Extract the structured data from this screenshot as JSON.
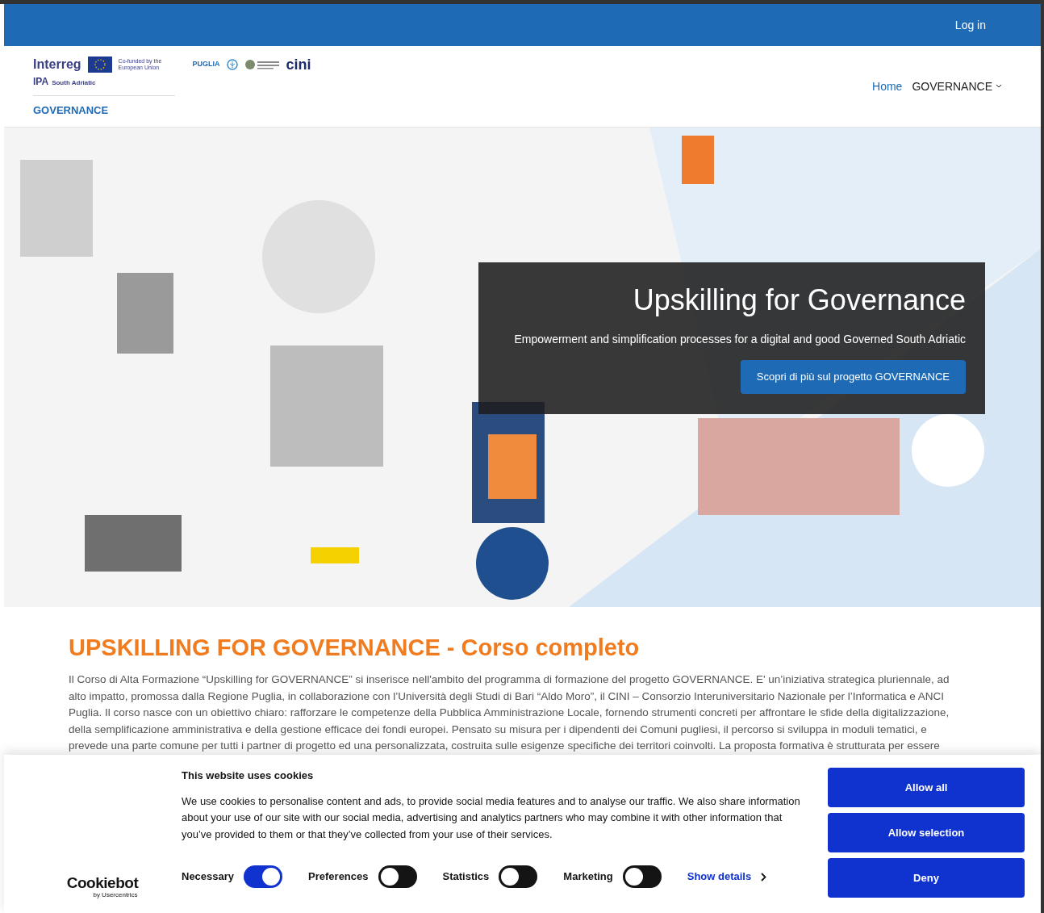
{
  "top_bar": {
    "login": "Log in"
  },
  "header": {
    "logos": {
      "interreg": "Interreg",
      "eu": "Co-funded by the European Union",
      "puglia": "PUGLIA",
      "cini": "cini",
      "ipa": "IPA",
      "region": "South Adriatic",
      "project": "GOVERNANCE"
    },
    "nav": [
      {
        "label": "Home",
        "selected": true,
        "dropdown": false
      },
      {
        "label": "GOVERNANCE",
        "selected": false,
        "dropdown": true
      }
    ]
  },
  "hero": {
    "title": "Upskilling for Governance",
    "subtitle": "Empowerment and simplification processes for a digital and good Governed South Adriatic",
    "button": "Scopri di più sul progetto GOVERNANCE"
  },
  "content": {
    "title": "UPSKILLING FOR GOVERNANCE - Corso completo",
    "paragraph": "Il Corso di Alta Formazione “Upskilling for GOVERNANCE” si inserisce nell'ambito del programma di formazione del progetto GOVERNANCE. E' un’iniziativa strategica pluriennale, ad alto impatto, promossa dalla Regione Puglia, in collaborazione con l’Università degli Studi di Bari “Aldo Moro”, il CINI – Consorzio Interuniversitario Nazionale per l’Informatica e ANCI Puglia. Il corso nasce con un obiettivo chiaro: rafforzare le competenze della Pubblica Amministrazione Locale, fornendo strumenti concreti per affrontare le sfide della digitalizzazione, della semplificazione amministrativa e della gestione efficace dei fondi europei. Pensato su misura per i dipendenti dei Comuni pugliesi, il percorso si sviluppa in moduli tematici, e prevede una parte comune per tutti i partner di progetto ed una personalizzata, costruita sulle esigenze specifiche dei territori coinvolti. La proposta formativa è strutturata per essere"
  },
  "cookie_banner": {
    "brand": "Cookiebot",
    "brand_sub": "by Usercentrics",
    "title": "This website uses cookies",
    "text": "We use cookies to personalise content and ads, to provide social media features and to analyse our traffic. We also share information about your use of our site with our social media, advertising and analytics partners who may combine it with other information that you’ve provided to them or that they’ve collected from your use of their services.",
    "toggles": [
      {
        "label": "Necessary",
        "on": true
      },
      {
        "label": "Preferences",
        "on": false
      },
      {
        "label": "Statistics",
        "on": false
      },
      {
        "label": "Marketing",
        "on": false
      }
    ],
    "show_details": "Show details",
    "buttons": [
      "Allow all",
      "Allow selection",
      "Deny"
    ]
  }
}
